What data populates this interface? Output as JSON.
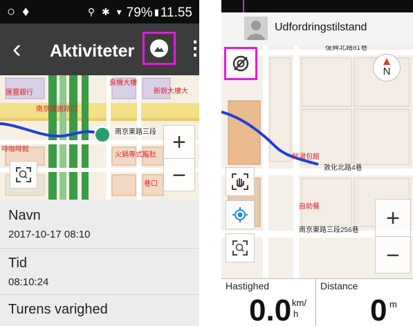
{
  "left": {
    "status_bar": {
      "time": "11.55",
      "battery": "79%"
    },
    "appbar": {
      "title": "Aktiviteter"
    },
    "map_labels": [
      "匯豐銀行",
      "南京建國路口",
      "良機大樓",
      "新銳大樓大",
      "南京東路三段",
      "啡咖啡館",
      "火鍋専式寵肚",
      "巷口"
    ],
    "info_rows": [
      {
        "label": "Navn",
        "value": "2017-10-17 08:10"
      },
      {
        "label": "Tid",
        "value": "08:10:24"
      },
      {
        "label": "Turens varighed",
        "value": ""
      }
    ]
  },
  "right": {
    "header": {
      "title": "Udfordringstilstand"
    },
    "compass": {
      "label": "N"
    },
    "map_labels": [
      "復興北路81巷",
      "鮮湯包館",
      "敦化北路4巷",
      "自助餐",
      "南京東路三段256巷"
    ],
    "stats": [
      {
        "label": "Hastighed",
        "value": "0.0",
        "unit_top": "km/",
        "unit_bottom": "h"
      },
      {
        "label": "Distance",
        "value": "0",
        "unit_top": "m",
        "unit_bottom": ""
      }
    ]
  },
  "colors": {
    "highlight": "#e21ce0",
    "route": "#1f3fd8",
    "position": "#2a9d6e",
    "road_yellow": "#f5e08a",
    "road_green": "#3a9c47"
  }
}
